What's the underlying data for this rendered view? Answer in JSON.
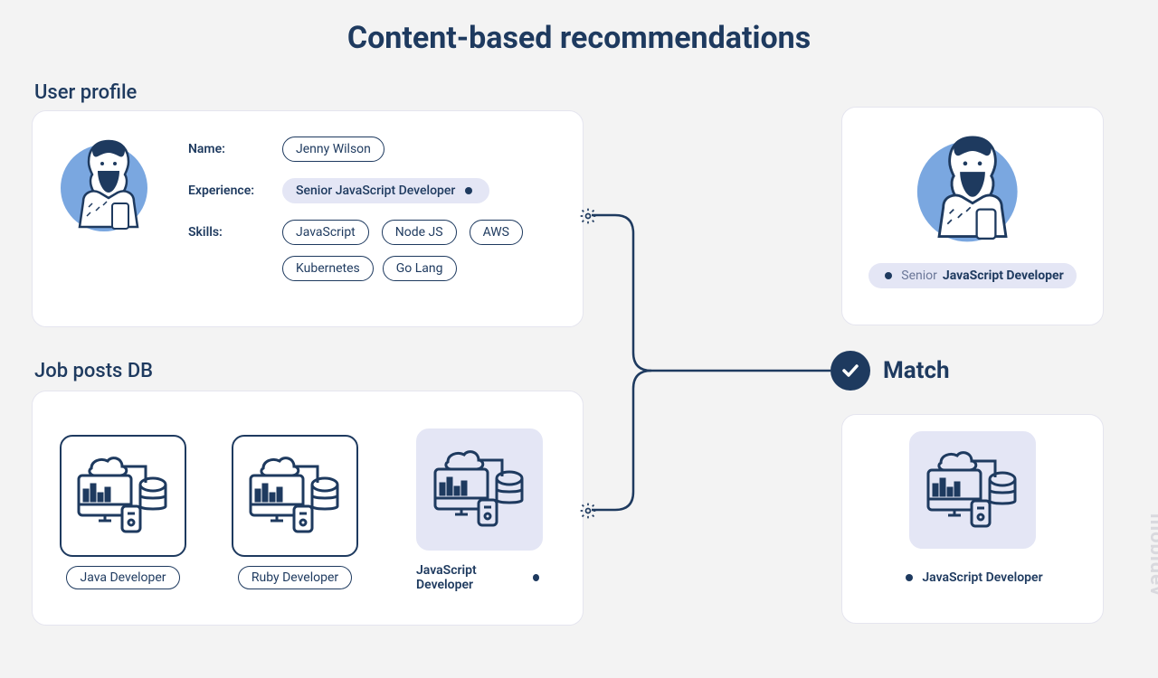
{
  "title": "Content-based recommendations",
  "sections": {
    "user_profile_label": "User profile",
    "job_posts_label": "Job posts DB"
  },
  "profile": {
    "name_label": "Name:",
    "name_value": "Jenny Wilson",
    "experience_label": "Experience:",
    "experience_value": "Senior JavaScript Developer",
    "skills_label": "Skills:",
    "skills": [
      "JavaScript",
      "Node JS",
      "AWS",
      "Kubernetes",
      "Go Lang"
    ]
  },
  "jobs": [
    {
      "label": "Java Developer",
      "highlighted": false
    },
    {
      "label": "Ruby Developer",
      "highlighted": false
    },
    {
      "label": "JavaScript Developer",
      "highlighted": true
    }
  ],
  "match": {
    "label": "Match",
    "user_tag_prefix": "Senior",
    "user_tag_bold": "JavaScript Developer",
    "job_tag": "JavaScript Developer"
  },
  "watermark": "mobidev"
}
